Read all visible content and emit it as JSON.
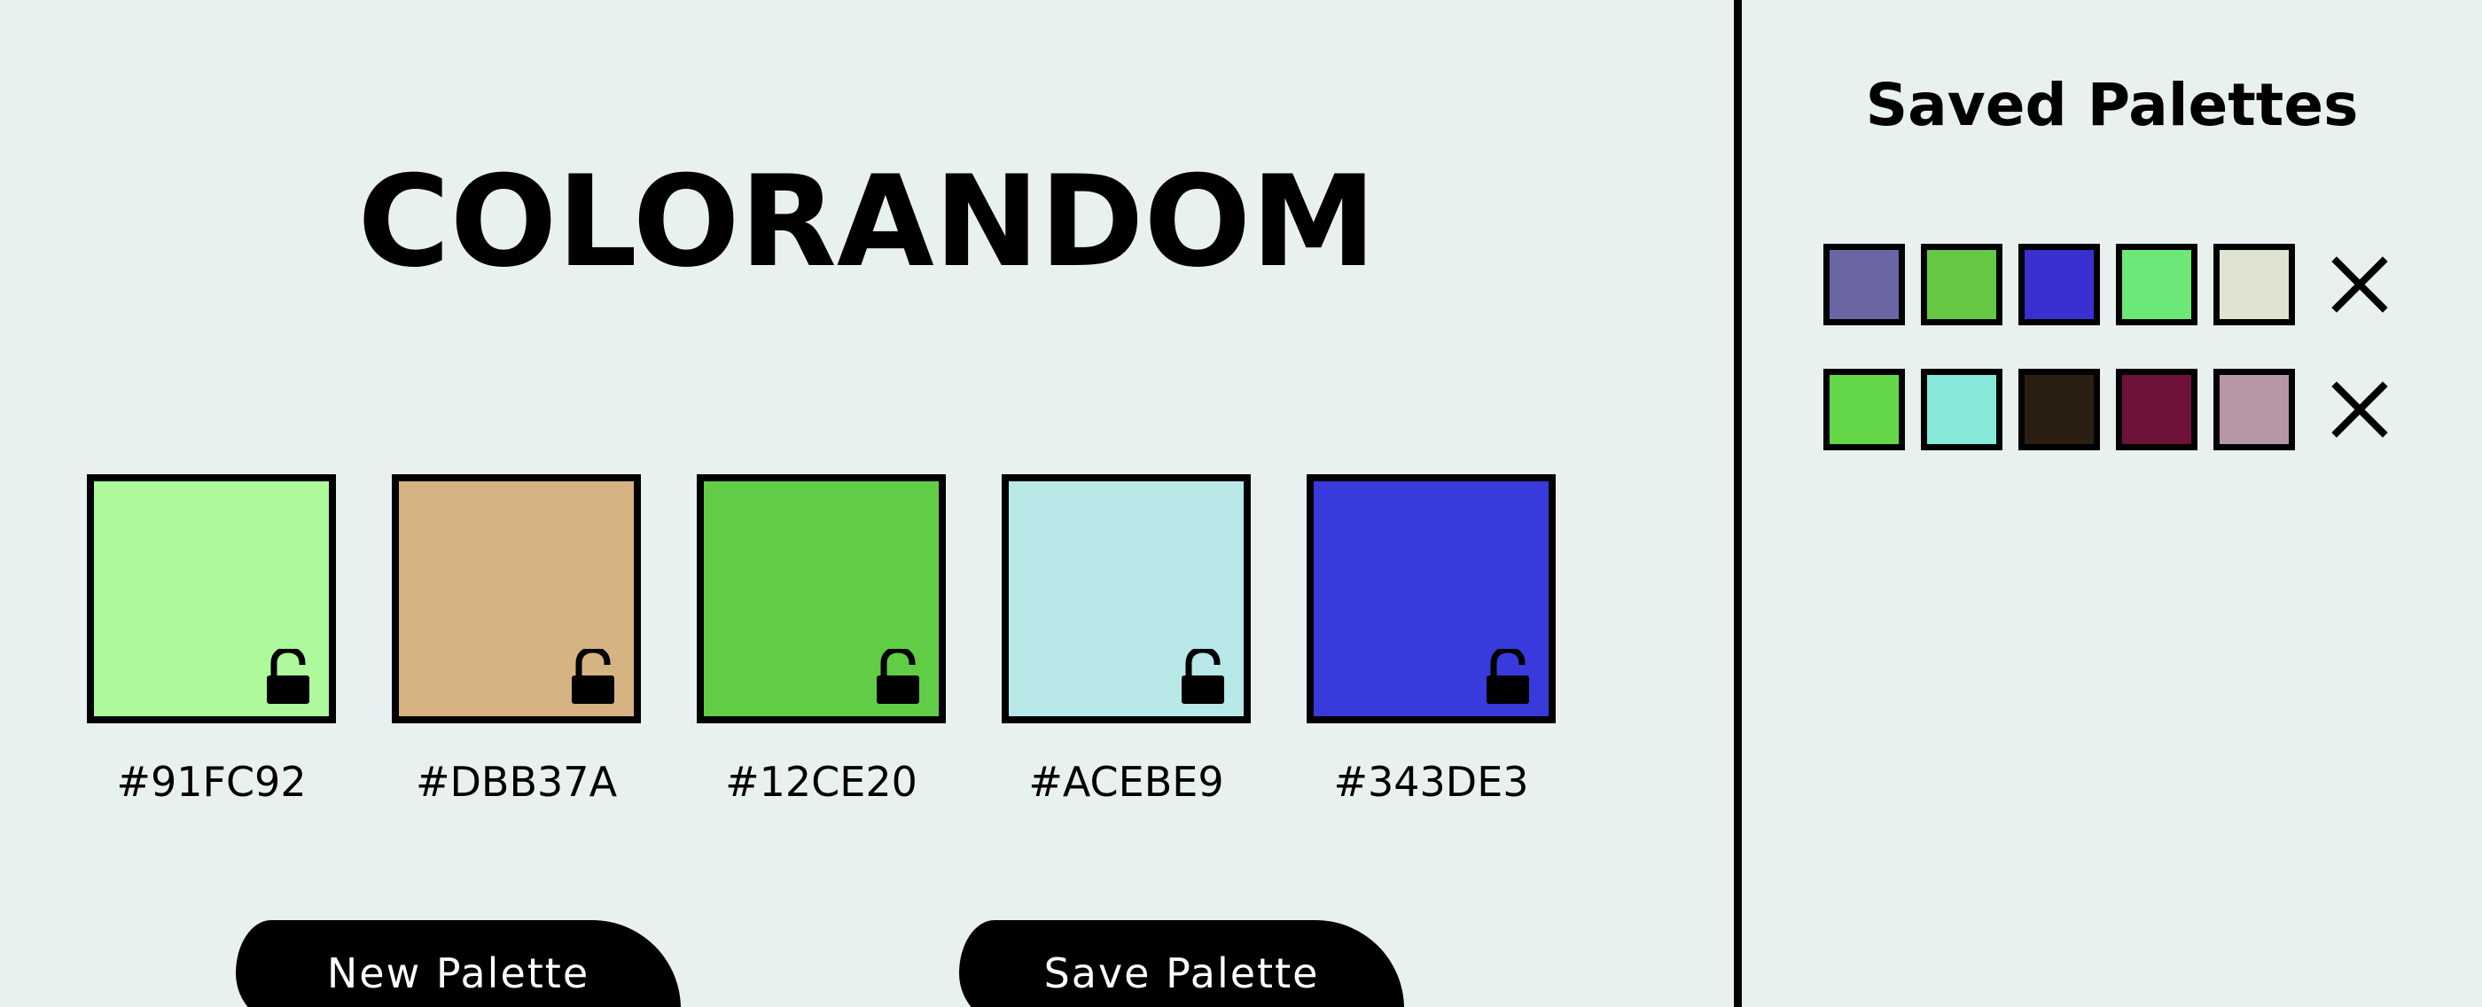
{
  "app": {
    "title": "COLORANDOM"
  },
  "palette": [
    {
      "hex": "#91FC92",
      "color": "#adf99b",
      "lock_icon": "unlock-icon"
    },
    {
      "hex": "#DBB37A",
      "color": "#d6b383",
      "lock_icon": "unlock-icon"
    },
    {
      "hex": "#12CE20",
      "color": "#61cd47",
      "lock_icon": "unlock-icon"
    },
    {
      "hex": "#ACEBE9",
      "color": "#b8e8e8",
      "lock_icon": "unlock-icon"
    },
    {
      "hex": "#343DE3",
      "color": "#383adb",
      "lock_icon": "unlock-icon"
    }
  ],
  "buttons": {
    "new_palette": "New Palette",
    "save_palette": "Save Palette"
  },
  "sidebar": {
    "title": "Saved Palettes",
    "saved_palettes": [
      {
        "colors": [
          "#6a66a3",
          "#65c844",
          "#3a2fd1",
          "#6be878",
          "#dfe4d1"
        ],
        "delete_icon": "close-icon"
      },
      {
        "colors": [
          "#63d748",
          "#87e8da",
          "#2b1f11",
          "#6e123a",
          "#b796a8"
        ],
        "delete_icon": "close-icon"
      }
    ]
  },
  "colors": {
    "background": "#e8f1f0",
    "ink": "#000000",
    "button_text": "#ffffff"
  }
}
